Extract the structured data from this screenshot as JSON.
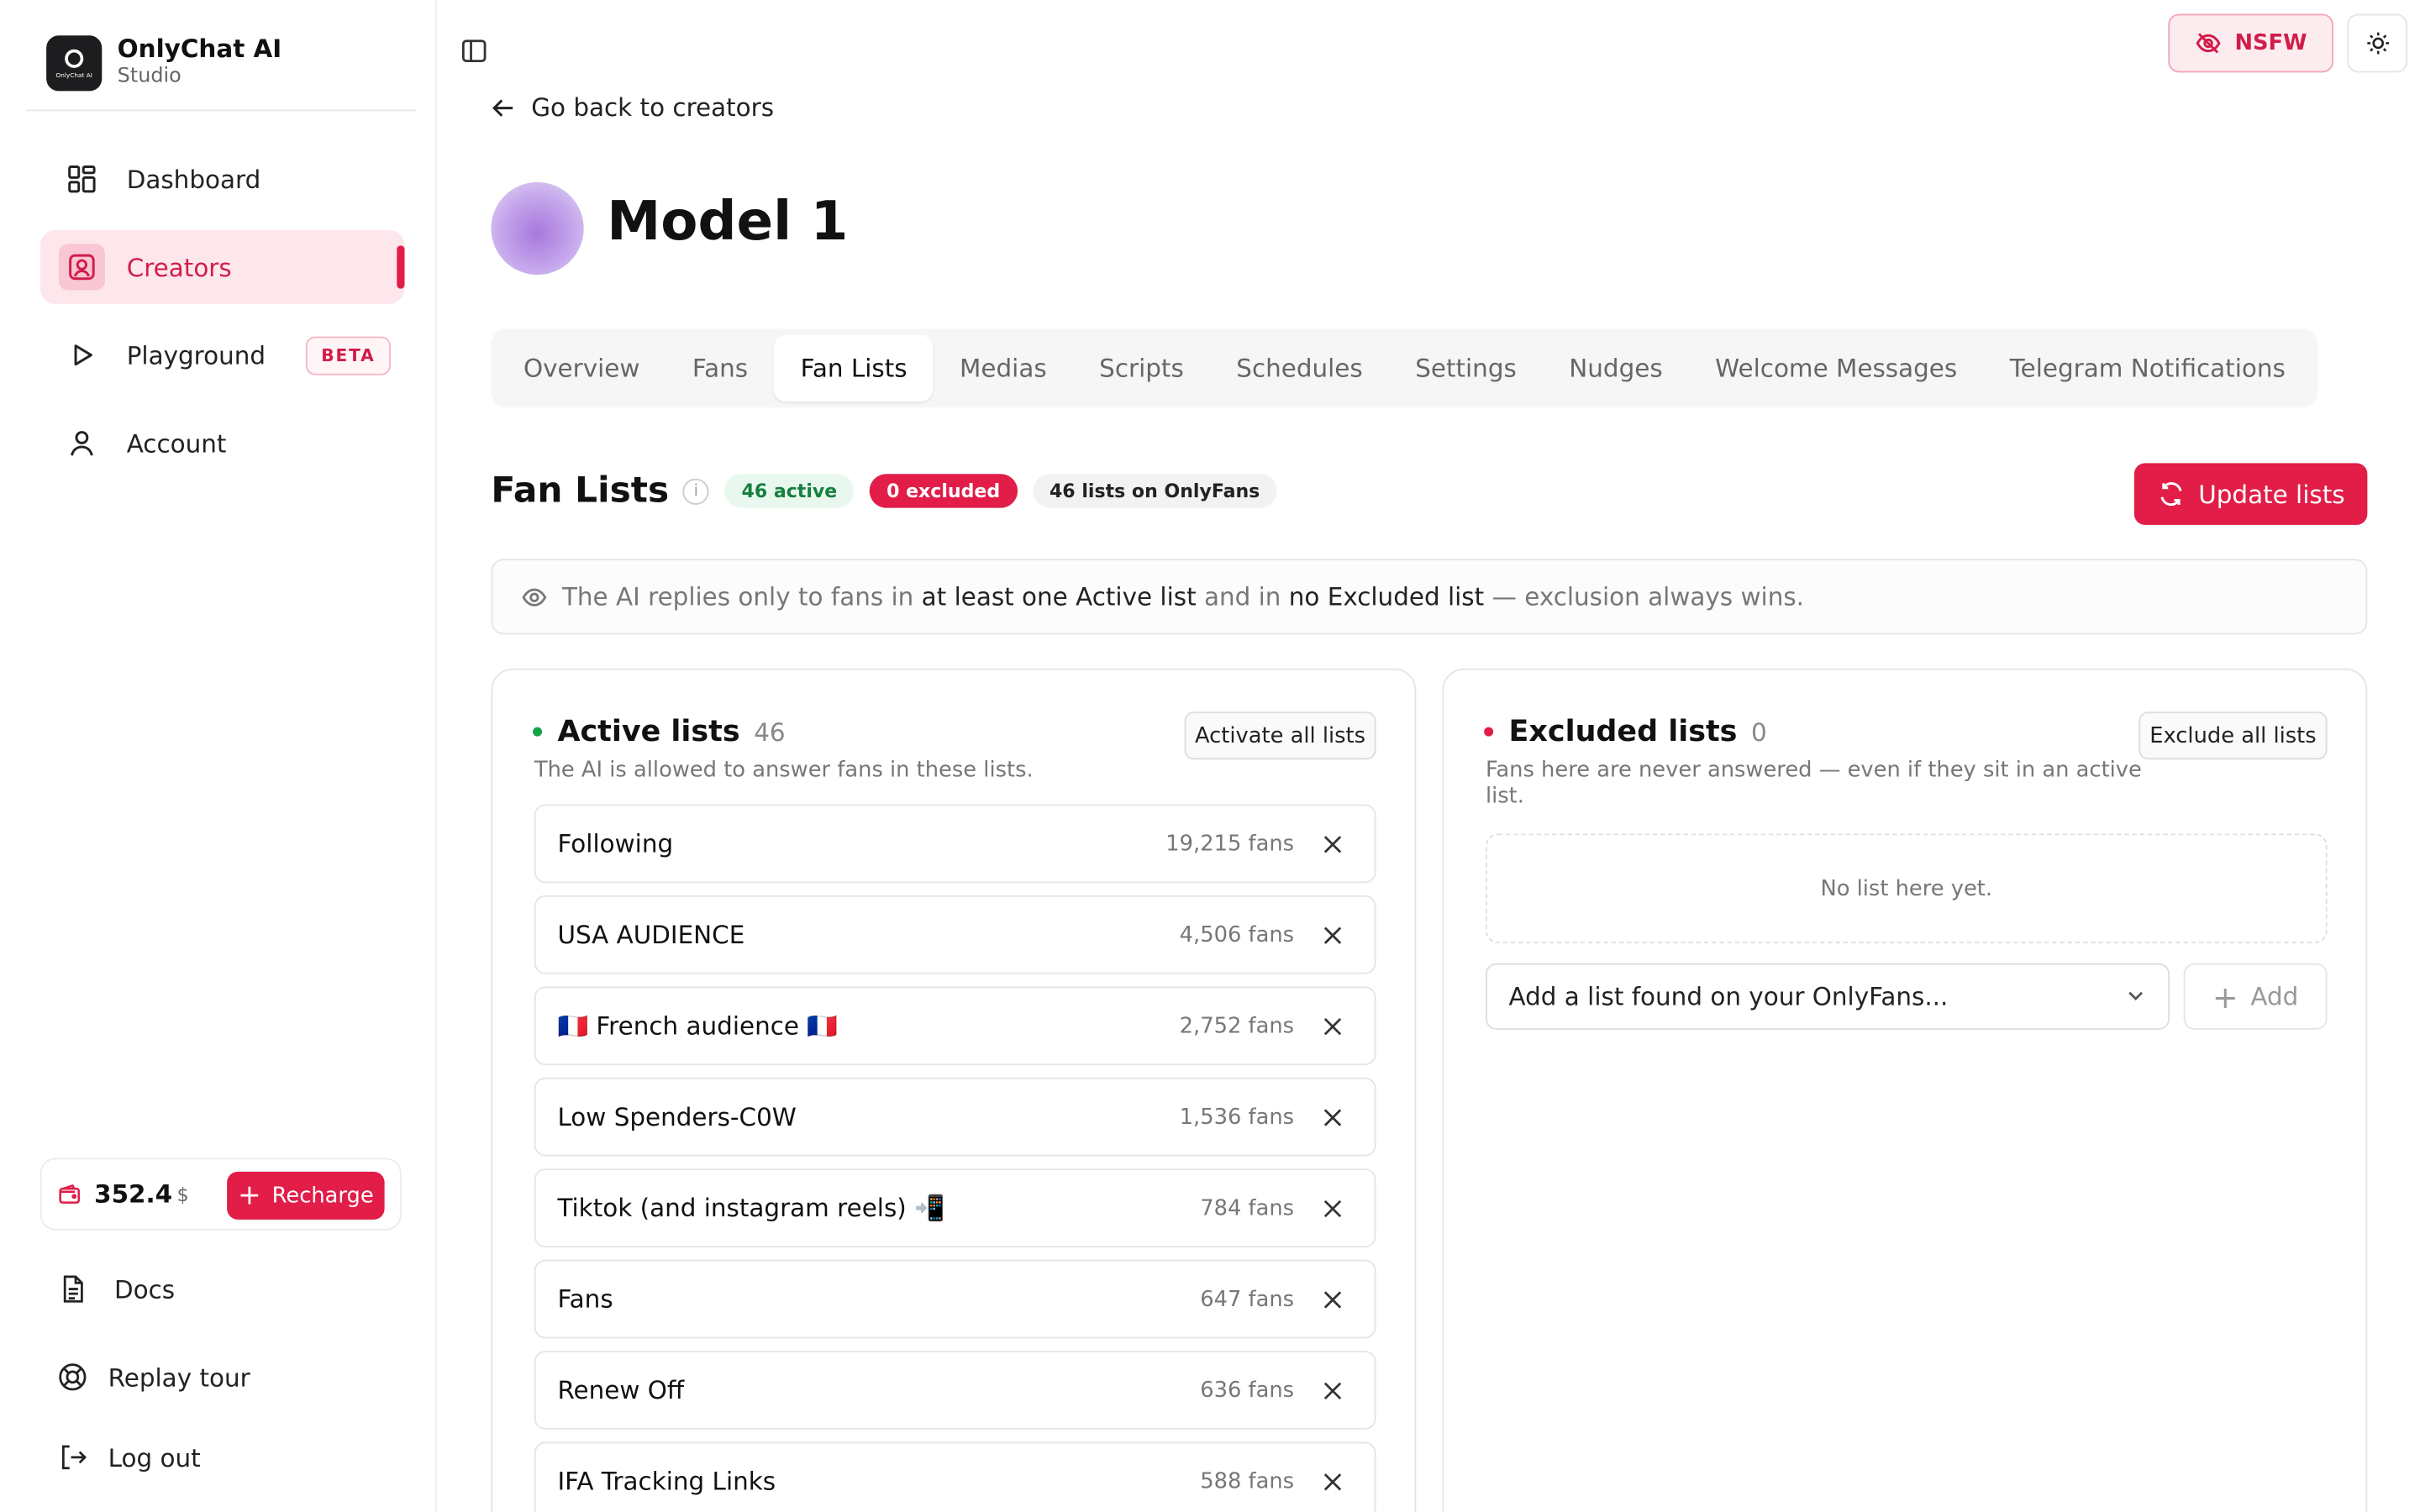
{
  "brand": {
    "title": "OnlyChat AI",
    "subtitle": "Studio",
    "logo_text": "OnlyChat AI"
  },
  "sidebar": {
    "items": [
      {
        "label": "Dashboard",
        "icon": "dashboard-grid-icon"
      },
      {
        "label": "Creators",
        "icon": "creator-portrait-icon",
        "active": true
      },
      {
        "label": "Playground",
        "icon": "play-icon",
        "badge": "BETA"
      },
      {
        "label": "Account",
        "icon": "user-icon"
      }
    ],
    "wallet": {
      "amount": "352.4",
      "currency": "$",
      "recharge_label": "Recharge"
    },
    "bottom": [
      {
        "label": "Docs",
        "icon": "document-icon"
      },
      {
        "label": "Replay tour",
        "icon": "lifebuoy-icon"
      },
      {
        "label": "Log out",
        "icon": "logout-icon"
      }
    ]
  },
  "topbar": {
    "nsfw_label": "NSFW"
  },
  "page": {
    "back_label": "Go back to creators",
    "title": "Model 1",
    "tabs": [
      "Overview",
      "Fans",
      "Fan Lists",
      "Medias",
      "Scripts",
      "Schedules",
      "Settings",
      "Nudges",
      "Welcome Messages",
      "Telegram Notifications"
    ],
    "active_tab": "Fan Lists"
  },
  "fan_lists": {
    "title": "Fan Lists",
    "info": "i",
    "badge_active": "46 active",
    "badge_excluded": "0 excluded",
    "badge_onlyfans": "46 lists on OnlyFans",
    "update_label": "Update lists",
    "notice": {
      "part1": "The AI replies only to fans in ",
      "strong1": "at least one Active list",
      "part2": " and in ",
      "strong2": "no Excluded list",
      "part3": " — exclusion always wins."
    }
  },
  "active_panel": {
    "title": "Active lists",
    "count": "46",
    "subtitle": "The AI is allowed to answer fans in these lists.",
    "button": "Activate all lists",
    "lists": [
      {
        "name": "Following",
        "fans": "19,215 fans"
      },
      {
        "name": "USA AUDIENCE",
        "fans": "4,506 fans"
      },
      {
        "name": "🇫🇷 French audience 🇫🇷",
        "fans": "2,752 fans"
      },
      {
        "name": "Low Spenders-C0W",
        "fans": "1,536 fans"
      },
      {
        "name": "Tiktok (and instagram reels) 📲",
        "fans": "784 fans"
      },
      {
        "name": "Fans",
        "fans": "647 fans"
      },
      {
        "name": "Renew Off",
        "fans": "636 fans"
      },
      {
        "name": "IFA Tracking Links",
        "fans": "588 fans"
      }
    ]
  },
  "excluded_panel": {
    "title": "Excluded lists",
    "count": "0",
    "subtitle_line1": "Fans here are never answered — even if they sit in an active",
    "subtitle_line2": "list.",
    "button": "Exclude all lists",
    "empty": "No list here yet.",
    "select_placeholder": "Add a list found on your OnlyFans...",
    "add_label": "Add"
  },
  "colors": {
    "accent": "#e11d48",
    "accent_soft": "#fde7ec",
    "green": "#16a34a"
  }
}
